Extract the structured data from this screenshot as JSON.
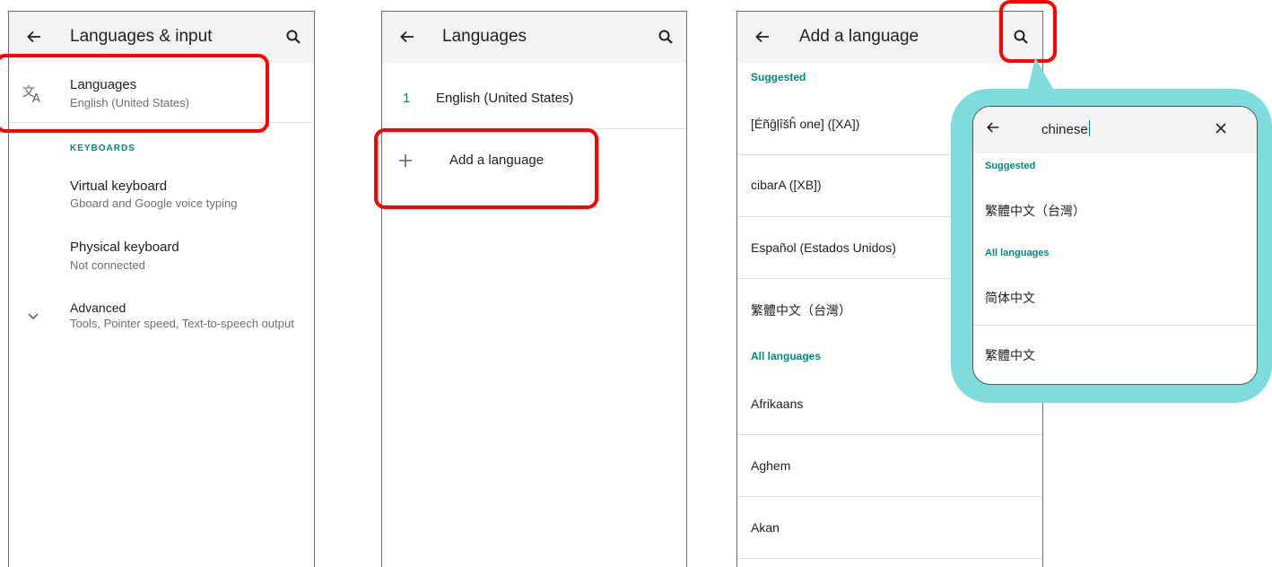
{
  "screen1": {
    "title": "Languages & input",
    "languages_label": "Languages",
    "languages_value": "English (United States)",
    "keyboards_header": "KEYBOARDS",
    "virtual_keyboard_label": "Virtual keyboard",
    "virtual_keyboard_value": "Gboard and Google voice typing",
    "physical_keyboard_label": "Physical keyboard",
    "physical_keyboard_value": "Not connected",
    "advanced_label": "Advanced",
    "advanced_value": "Tools, Pointer speed, Text-to-speech output"
  },
  "screen2": {
    "title": "Languages",
    "items": [
      {
        "index": "1",
        "label": "English (United States)"
      }
    ],
    "add_label": "Add a language"
  },
  "screen3": {
    "title": "Add a language",
    "suggested_header": "Suggested",
    "suggested": [
      "[Éñĝļîšĥ one] ([XA])",
      "cibarA ([XB])",
      "Español (Estados Unidos)",
      "繁體中文（台灣）"
    ],
    "all_header": "All languages",
    "all": [
      "Afrikaans",
      "Aghem",
      "Akan"
    ]
  },
  "search_popup": {
    "query": "chinese",
    "suggested_header": "Suggested",
    "suggested": [
      "繁體中文（台灣）"
    ],
    "all_header": "All languages",
    "all": [
      "简体中文",
      "繁體中文"
    ]
  },
  "colors": {
    "accent": "#00897b",
    "highlight": "#ff0000",
    "popup_frame": "#7fdcdc"
  },
  "icons": [
    "back-arrow-icon",
    "search-icon",
    "translate-icon",
    "chevron-down-icon",
    "plus-icon",
    "close-icon"
  ]
}
